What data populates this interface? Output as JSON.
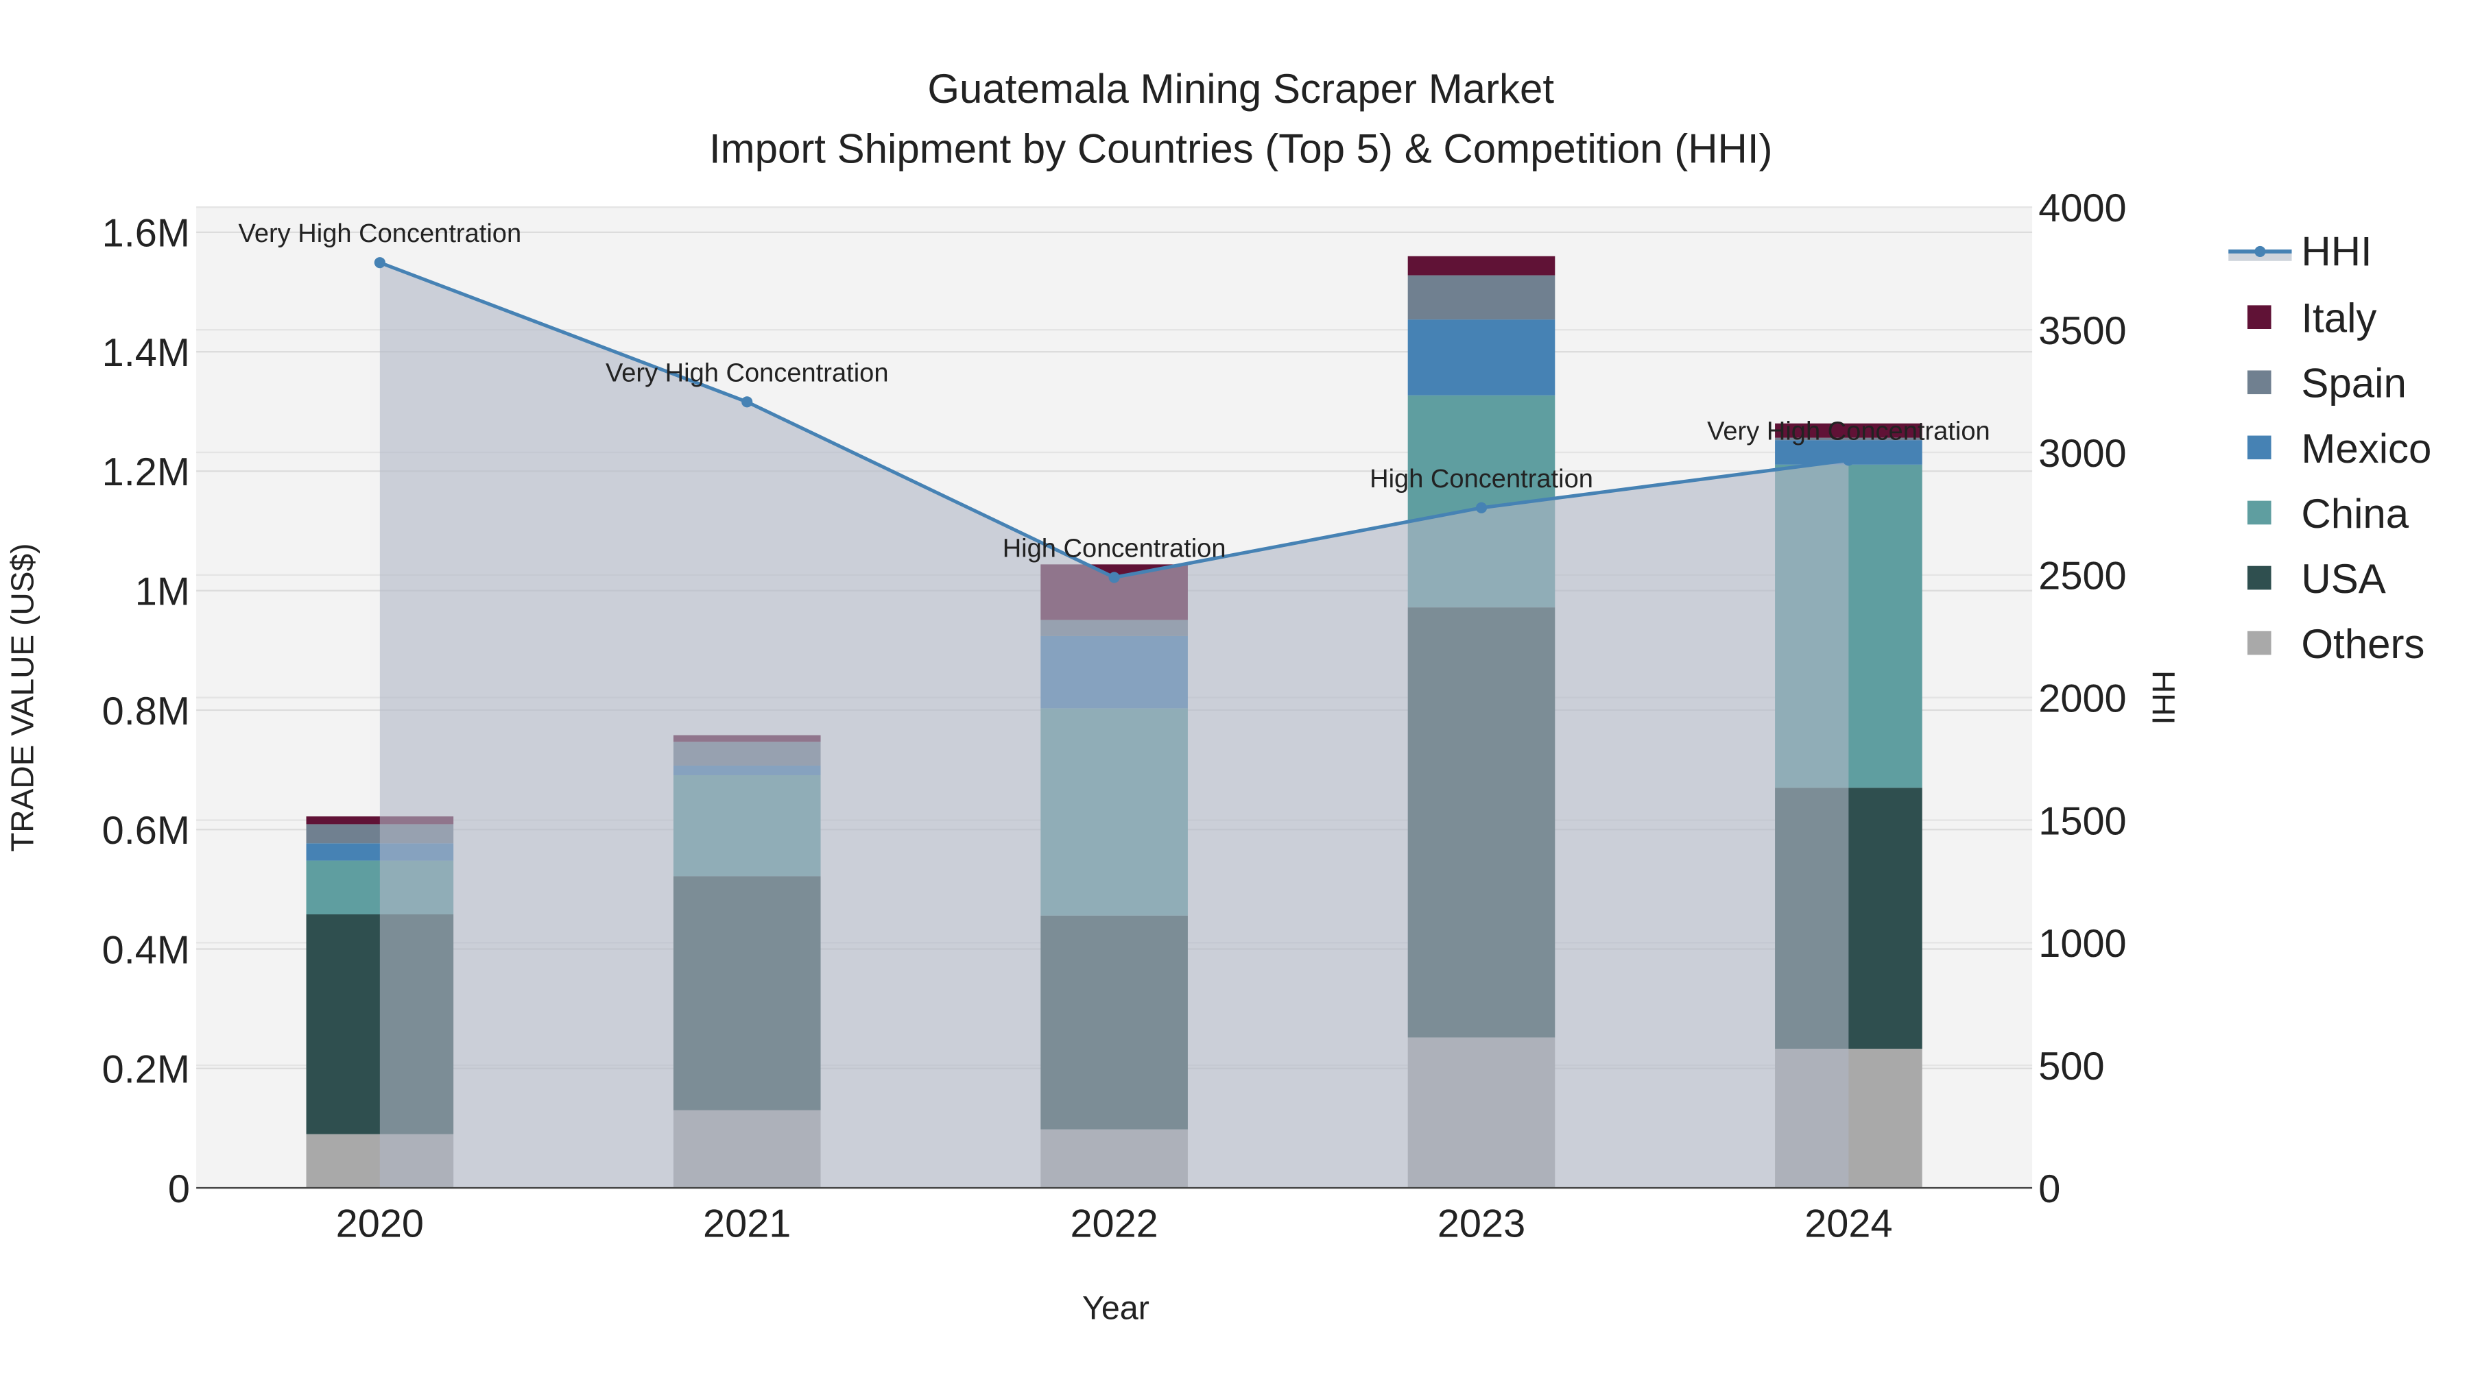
{
  "chart_data": {
    "type": "bar",
    "title": "Guatemala Mining Scraper Market",
    "subtitle": "Import Shipment by Countries (Top 5) & Competition (HHI)",
    "xlabel": "Year",
    "ylabel": "TRADE VALUE (US$)",
    "y2label": "HHI",
    "categories": [
      "2020",
      "2021",
      "2022",
      "2023",
      "2024"
    ],
    "ylim": [
      0,
      1642000
    ],
    "y2lim": [
      0,
      4000
    ],
    "yticks": [
      0,
      200000,
      400000,
      600000,
      800000,
      1000000,
      1200000,
      1400000,
      1600000
    ],
    "ytick_labels": [
      "0",
      "0.2M",
      "0.4M",
      "0.6M",
      "0.8M",
      "1M",
      "1.2M",
      "1.4M",
      "1.6M"
    ],
    "y2ticks": [
      0,
      500,
      1000,
      1500,
      2000,
      2500,
      3000,
      3500,
      4000
    ],
    "y2tick_labels": [
      "0",
      "500",
      "1000",
      "1500",
      "2000",
      "2500",
      "3000",
      "3500",
      "4000"
    ],
    "grid": true,
    "legend_placement": "right",
    "series": [
      {
        "name": "Others",
        "color": "#A9A9A9",
        "values": [
          90000,
          130000,
          98000,
          252000,
          233000
        ]
      },
      {
        "name": "USA",
        "color": "#2F4F4F",
        "values": [
          368000,
          392000,
          358000,
          720000,
          437000
        ]
      },
      {
        "name": "China",
        "color": "#5F9EA0",
        "values": [
          90000,
          169000,
          347000,
          355000,
          541000
        ]
      },
      {
        "name": "Mexico",
        "color": "#4682B4",
        "values": [
          29000,
          16000,
          121000,
          127000,
          41000
        ]
      },
      {
        "name": "Spain",
        "color": "#708090",
        "values": [
          32000,
          40000,
          27000,
          74000,
          4000
        ]
      },
      {
        "name": "Italy",
        "color": "#601236",
        "values": [
          13000,
          11000,
          93000,
          32000,
          24000
        ]
      }
    ],
    "hhi": {
      "name": "HHI",
      "color": "#4682B4",
      "fill": "rgba(176,184,198,0.6)",
      "values": [
        3774,
        3206,
        2490,
        2774,
        2968
      ],
      "annotations": [
        "Very High Concentration",
        "Very High Concentration",
        "High Concentration",
        "High Concentration",
        "Very High Concentration"
      ]
    },
    "legend_order": [
      "HHI",
      "Italy",
      "Spain",
      "Mexico",
      "China",
      "USA",
      "Others"
    ]
  }
}
